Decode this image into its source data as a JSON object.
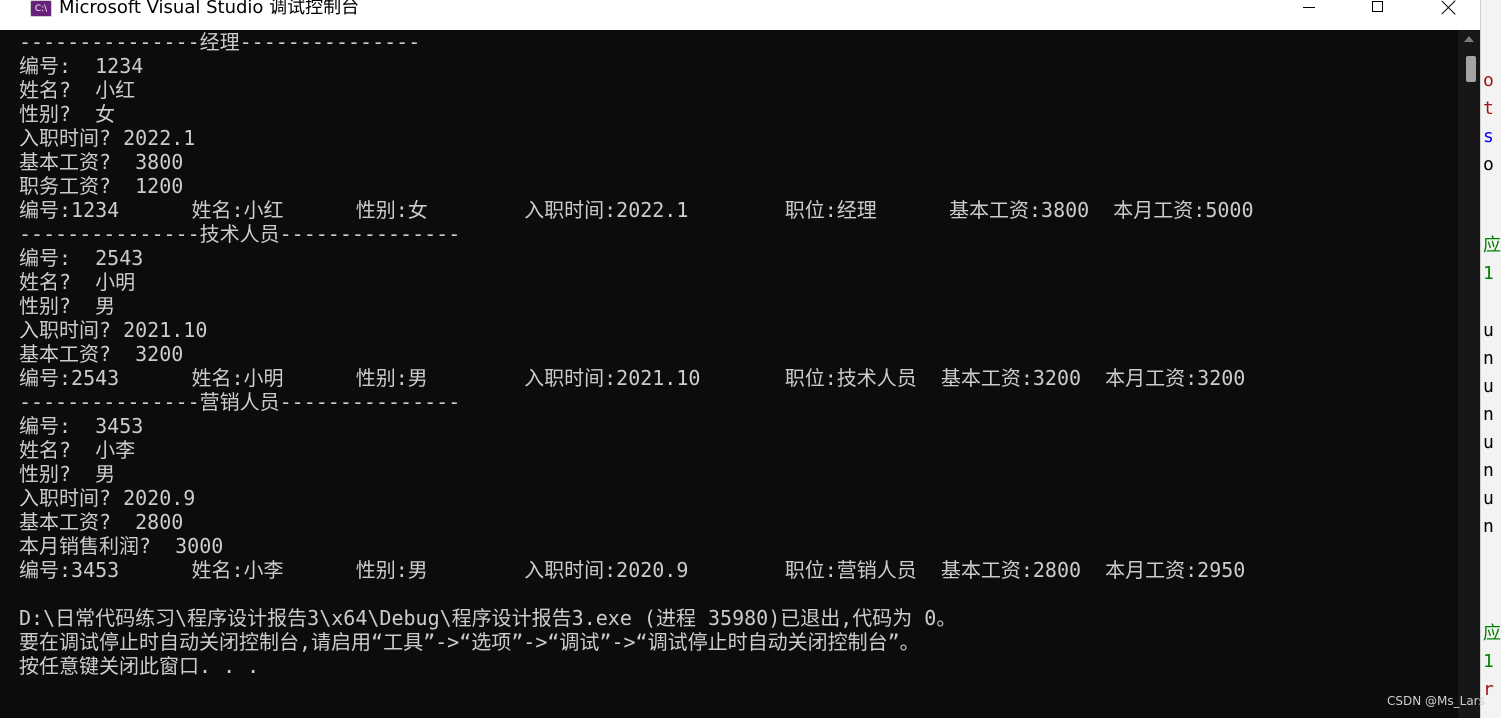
{
  "window": {
    "title": "Microsoft Visual Studio 调试控制台",
    "icon_text": "C:\\"
  },
  "console": {
    "lines": [
      "---------------经理---------------",
      "编号:  1234",
      "姓名?  小红",
      "性别?  女",
      "入职时间? 2022.1",
      "基本工资?  3800",
      "职务工资?  1200",
      "编号:1234      姓名:小红      性别:女        入职时间:2022.1        职位:经理      基本工资:3800  本月工资:5000",
      "---------------技术人员---------------",
      "编号:  2543",
      "姓名?  小明",
      "性别?  男",
      "入职时间? 2021.10",
      "基本工资?  3200",
      "编号:2543      姓名:小明      性别:男        入职时间:2021.10       职位:技术人员  基本工资:3200  本月工资:3200",
      "---------------营销人员---------------",
      "编号:  3453",
      "姓名?  小李",
      "性别?  男",
      "入职时间? 2020.9",
      "基本工资?  2800",
      "本月销售利润?  3000",
      "编号:3453      姓名:小李      性别:男        入职时间:2020.9        职位:营销人员  基本工资:2800  本月工资:2950",
      "",
      "D:\\日常代码练习\\程序设计报告3\\x64\\Debug\\程序设计报告3.exe (进程 35980)已退出,代码为 0。",
      "要在调试停止时自动关闭控制台,请启用“工具”->“选项”->“调试”->“调试停止时自动关闭控制台”。",
      "按任意键关闭此窗口. . ."
    ]
  },
  "ide_edge_glyphs": [
    "o",
    "t",
    "s",
    "o",
    "应",
    "1",
    "u",
    "n",
    "u",
    "n",
    "u",
    "n",
    "u",
    "n",
    "应",
    "1",
    "r"
  ],
  "watermark": "CSDN @Ms_Lars",
  "colors": {
    "console_bg": "#0c0c0c",
    "console_fg": "#cccccc",
    "titlebar_bg": "#ffffff",
    "vs_purple": "#68217a"
  }
}
